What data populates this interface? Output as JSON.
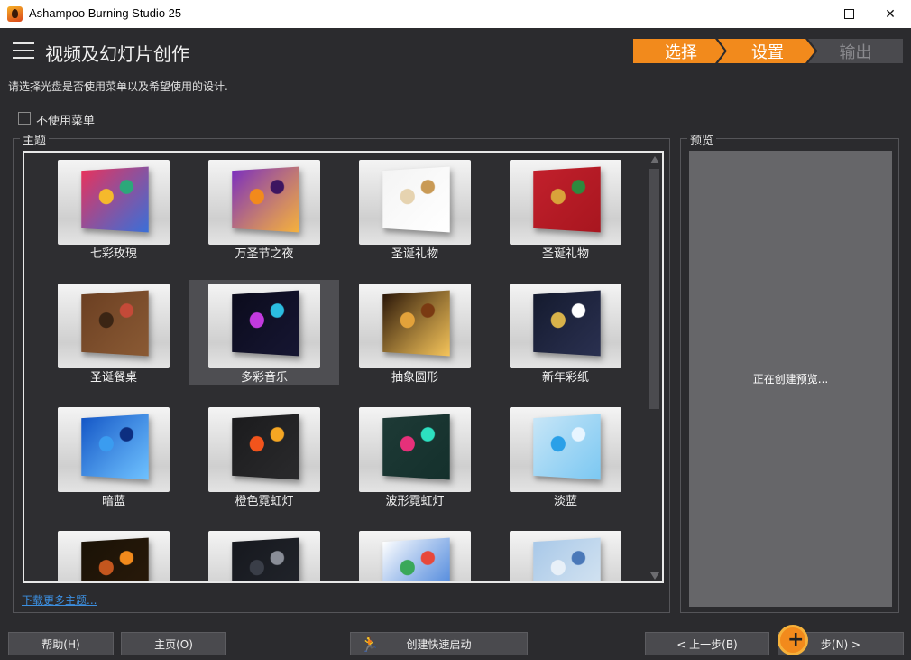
{
  "window": {
    "title": "Ashampoo Burning Studio 25"
  },
  "header": {
    "title": "视频及幻灯片创作"
  },
  "steps": [
    {
      "label": "选择",
      "state": "done"
    },
    {
      "label": "设置",
      "state": "active"
    },
    {
      "label": "输出",
      "state": "pending"
    }
  ],
  "instruction": "请选择光盘是否使用菜单以及希望使用的设计.",
  "no_menu": {
    "label": "不使用菜单",
    "checked": false
  },
  "themes": {
    "group_label": "主题",
    "items": [
      {
        "label": "七彩玫瑰",
        "selected": false,
        "colors": [
          "#e8325c",
          "#f5b92c",
          "#2ca87a",
          "#3a6fd8"
        ]
      },
      {
        "label": "万圣节之夜",
        "selected": false,
        "colors": [
          "#7b2fbe",
          "#f28a1c",
          "#3d1560",
          "#f6b23c"
        ]
      },
      {
        "label": "圣诞礼物",
        "selected": false,
        "colors": [
          "#f4f4f4",
          "#e6d3b0",
          "#c99a55",
          "#ffffff"
        ]
      },
      {
        "label": "圣诞礼物",
        "selected": false,
        "colors": [
          "#c2202c",
          "#d9a23a",
          "#2d8a3e",
          "#a8161f"
        ]
      },
      {
        "label": "圣诞餐桌",
        "selected": false,
        "colors": [
          "#6b3f22",
          "#3b2514",
          "#c44a38",
          "#8a5a34"
        ]
      },
      {
        "label": "多彩音乐",
        "selected": true,
        "colors": [
          "#0b0b1c",
          "#c23adf",
          "#2bbde0",
          "#161632"
        ]
      },
      {
        "label": "抽象圆形",
        "selected": false,
        "colors": [
          "#2a1608",
          "#e3a23a",
          "#7a3a12",
          "#f5c45a"
        ]
      },
      {
        "label": "新年彩纸",
        "selected": false,
        "colors": [
          "#141a2e",
          "#d8b24a",
          "#ffffff",
          "#2a3050"
        ]
      },
      {
        "label": "暗蓝",
        "selected": false,
        "colors": [
          "#1456c6",
          "#3a9cf0",
          "#0c2e80",
          "#6fc2ff"
        ]
      },
      {
        "label": "橙色霓虹灯",
        "selected": false,
        "colors": [
          "#1b1b1d",
          "#f2541c",
          "#f5a623",
          "#2a2a2c"
        ]
      },
      {
        "label": "波形霓虹灯",
        "selected": false,
        "colors": [
          "#1e3a36",
          "#e6307a",
          "#2de0c0",
          "#14302c"
        ]
      },
      {
        "label": "淡蓝",
        "selected": false,
        "colors": [
          "#c8e6f7",
          "#2aa0e8",
          "#e8f5ff",
          "#7cc8f2"
        ]
      },
      {
        "label": "",
        "selected": false,
        "colors": [
          "#1a1206",
          "#c4561e",
          "#f28a1c",
          "#2a1a0a"
        ]
      },
      {
        "label": "",
        "selected": false,
        "colors": [
          "#16181e",
          "#3a3e48",
          "#8a8e98",
          "#22252c"
        ]
      },
      {
        "label": "",
        "selected": false,
        "colors": [
          "#ffffff",
          "#3aa85a",
          "#e8483a",
          "#3a7ad8"
        ]
      },
      {
        "label": "",
        "selected": false,
        "colors": [
          "#a8c8e8",
          "#e8f0f8",
          "#4a78b8",
          "#d8e6f2"
        ]
      }
    ],
    "download_link": "下载更多主题..."
  },
  "preview": {
    "group_label": "预览",
    "status": "正在创建预览..."
  },
  "footer": {
    "help": "帮助(H)",
    "home": "主页(O)",
    "quick_launch": "创建快速启动",
    "prev": "< 上一步(B)",
    "next": "步(N) >"
  },
  "accent_color": "#f28a1c"
}
